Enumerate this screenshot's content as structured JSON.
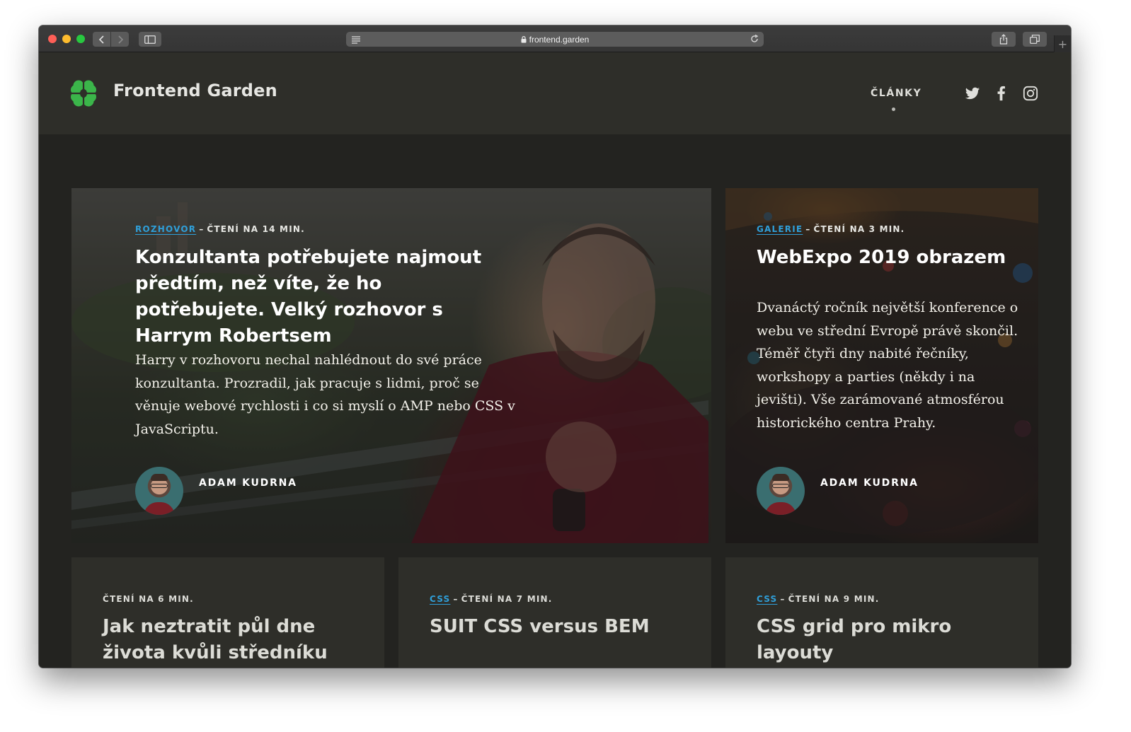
{
  "browser": {
    "url": "frontend.garden",
    "new_tab": "+"
  },
  "site": {
    "brand": "Frontend Garden",
    "nav": {
      "articles": "ČLÁNKY"
    },
    "social_icons": [
      "twitter-icon",
      "facebook-icon",
      "instagram-icon"
    ],
    "accent_color": "#2f9fd9",
    "logo_color": "#3bb54a"
  },
  "featured": [
    {
      "tag": "ROZHOVOR",
      "separator": "–",
      "reading": "ČTENÍ NA 14 MIN.",
      "title": "Konzultanta potřebujete najmout předtím, než víte, že ho potřebujete. Velký rozhovor s Harrym Robertsem",
      "perex": "Harry v rozhovoru nechal nahlédnout do své práce konzultanta. Prozradil, jak pracuje s lidmi, proč se věnuje webové rychlosti i co si myslí o AMP nebo CSS v JavaScriptu.",
      "author": "ADAM KUDRNA"
    },
    {
      "tag": "GALERIE",
      "separator": "–",
      "reading": "ČTENÍ NA 3 MIN.",
      "title": "WebExpo 2019 obrazem",
      "perex": "Dvanáctý ročník největší konference o webu ve střední Evropě právě skončil. Téměř čtyři dny nabité řečníky, workshopy a parties (někdy i na jevišti). Vše zarámované atmosférou historického centra Prahy.",
      "author": "ADAM KUDRNA"
    }
  ],
  "articles": [
    {
      "tag": "",
      "reading": "ČTENÍ NA 6 MIN.",
      "title": "Jak neztratit půl dne života kvůli středníku"
    },
    {
      "tag": "CSS",
      "separator": "–",
      "reading": "ČTENÍ NA 7 MIN.",
      "title": "SUIT CSS versus BEM"
    },
    {
      "tag": "CSS",
      "separator": "–",
      "reading": "ČTENÍ NA 9 MIN.",
      "title": "CSS grid pro mikro layouty"
    }
  ]
}
